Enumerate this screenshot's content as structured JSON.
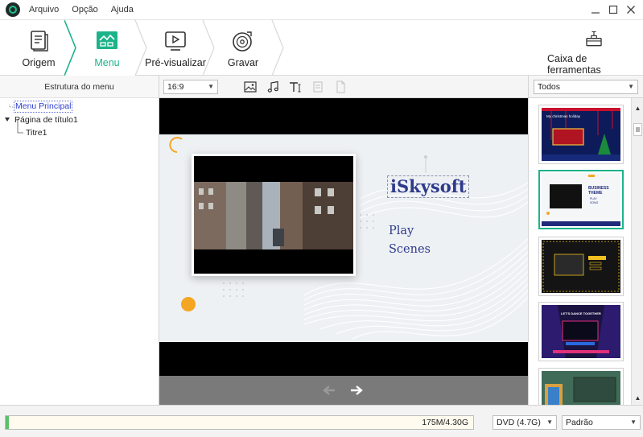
{
  "menubar": {
    "items": [
      "Arquivo",
      "Opção",
      "Ajuda"
    ]
  },
  "steps": [
    {
      "label": "Origem",
      "icon": "source-icon"
    },
    {
      "label": "Menu",
      "icon": "menu-template-icon",
      "active": true
    },
    {
      "label": "Pré-visualizar",
      "icon": "preview-icon"
    },
    {
      "label": "Gravar",
      "icon": "burn-disc-icon"
    }
  ],
  "toolbox": {
    "label": "Caixa de ferramentas",
    "icon": "toolbox-icon"
  },
  "left_panel": {
    "title": "Estrutura do menu",
    "tree": {
      "root": "Menu Principal",
      "child": "Página de título1",
      "leaf": "Titre1"
    }
  },
  "center_toolbar": {
    "aspect_ratio": "16:9",
    "tools": [
      "image-icon",
      "music-icon",
      "text-icon",
      "copy-icon",
      "paste-icon"
    ]
  },
  "preview": {
    "brand_text": "iSkysoft",
    "buttons": [
      "Play",
      "Scenes"
    ],
    "accent_orange": "#f4a623",
    "text_blue": "#2d3a8c"
  },
  "right_panel": {
    "filter": "Todos",
    "templates": [
      {
        "name": "christmas-template",
        "caption": "My christmas holiday"
      },
      {
        "name": "business-template",
        "caption": "BUSINESS THEME",
        "selected": true,
        "items": [
          "PLAY",
          "SONG"
        ]
      },
      {
        "name": "dark-yellow-template",
        "caption": ""
      },
      {
        "name": "neon-stage-template",
        "caption": "LET'S DANCE TOGETHER"
      },
      {
        "name": "chalkboard-template",
        "caption": ""
      }
    ]
  },
  "status": {
    "usage": "175M/4.30G",
    "progress_fraction": 0.007,
    "disc_type": "DVD (4.7G)",
    "quality": "Padrão"
  },
  "colors": {
    "accent": "#1db38a",
    "selection_blue": "#2b3ed0"
  }
}
